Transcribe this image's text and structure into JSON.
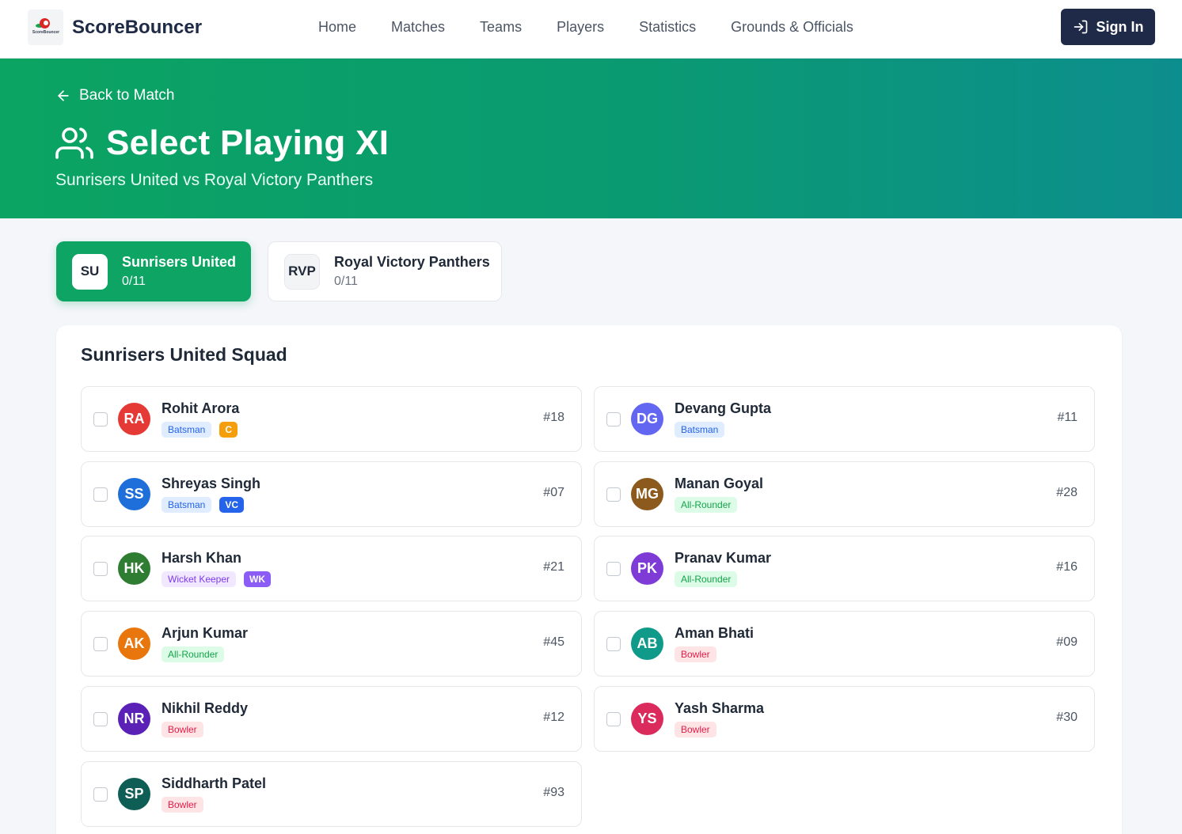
{
  "header": {
    "brand": "ScoreBouncer",
    "logo_text": "ScoreBouncer",
    "nav": [
      "Home",
      "Matches",
      "Teams",
      "Players",
      "Statistics",
      "Grounds & Officials"
    ],
    "sign_in": "Sign In"
  },
  "hero": {
    "back": "Back to Match",
    "title": "Select Playing XI",
    "subtitle": "Sunrisers United vs Royal Victory Panthers"
  },
  "tabs": [
    {
      "abbr": "SU",
      "name": "Sunrisers United",
      "count": "0/11"
    },
    {
      "abbr": "RVP",
      "name": "Royal Victory Panthers",
      "count": "0/11"
    }
  ],
  "squad": {
    "title": "Sunrisers United Squad",
    "players": [
      {
        "initials": "RA",
        "name": "Rohit Arora",
        "role": "Batsman",
        "tag": "C",
        "number": "#18",
        "color": "#e53935"
      },
      {
        "initials": "DG",
        "name": "Devang Gupta",
        "role": "Batsman",
        "tag": "",
        "number": "#11",
        "color": "#6366f1"
      },
      {
        "initials": "SS",
        "name": "Shreyas Singh",
        "role": "Batsman",
        "tag": "VC",
        "number": "#07",
        "color": "#1e6fd9"
      },
      {
        "initials": "MG",
        "name": "Manan Goyal",
        "role": "All-Rounder",
        "tag": "",
        "number": "#28",
        "color": "#8b5a1c"
      },
      {
        "initials": "HK",
        "name": "Harsh Khan",
        "role": "Wicket Keeper",
        "tag": "WK",
        "number": "#21",
        "color": "#2e7d32"
      },
      {
        "initials": "PK",
        "name": "Pranav Kumar",
        "role": "All-Rounder",
        "tag": "",
        "number": "#16",
        "color": "#7e3bd6"
      },
      {
        "initials": "AK",
        "name": "Arjun Kumar",
        "role": "All-Rounder",
        "tag": "",
        "number": "#45",
        "color": "#e8760c"
      },
      {
        "initials": "AB",
        "name": "Aman Bhati",
        "role": "Bowler",
        "tag": "",
        "number": "#09",
        "color": "#0f9a8a"
      },
      {
        "initials": "NR",
        "name": "Nikhil Reddy",
        "role": "Bowler",
        "tag": "",
        "number": "#12",
        "color": "#5b21b6"
      },
      {
        "initials": "YS",
        "name": "Yash Sharma",
        "role": "Bowler",
        "tag": "",
        "number": "#30",
        "color": "#db2b5c"
      },
      {
        "initials": "SP",
        "name": "Siddharth Patel",
        "role": "Bowler",
        "tag": "",
        "number": "#93",
        "color": "#0f5e55"
      }
    ]
  }
}
